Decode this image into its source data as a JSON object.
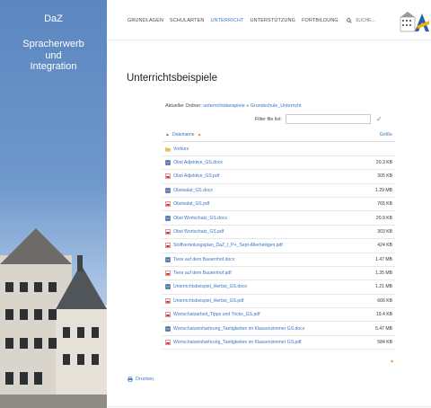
{
  "sidebar": {
    "brand_short": "DaZ",
    "brand_long_1": "Spracherwerb",
    "brand_long_2": "und",
    "brand_long_3": "Integration"
  },
  "nav": {
    "items": [
      "GRUNDLAGEN",
      "SCHULARTEN",
      "UNTERRICHT",
      "UNTERSTÜTZUNG",
      "FORTBILDUNG"
    ],
    "active_index": 2
  },
  "search": {
    "placeholder": "SUCHE..."
  },
  "page": {
    "title": "Unterrichtsbeispiele",
    "folder_label": "Aktueller Ordner:",
    "folder_link_1": "unterrichtsbeispiele",
    "folder_sep": "»",
    "folder_link_2": "Grundschule_Unterricht",
    "filter_label": "Filter file list:"
  },
  "listing": {
    "header_name": "Dateiname",
    "header_size": "Größe",
    "rows": [
      {
        "name": "Vorkurs",
        "size": "",
        "icon": "folder-icon"
      },
      {
        "name": "Obst Adjektive_GS.docx",
        "size": "20.3 KB",
        "icon": "word-icon"
      },
      {
        "name": "Obst Adjektive_GS.pdf",
        "size": "305 KB",
        "icon": "pdf-icon"
      },
      {
        "name": "Obstsalat_GS.docx",
        "size": "1.29 MB",
        "icon": "word-icon"
      },
      {
        "name": "Obstsalat_GS.pdf",
        "size": "765 KB",
        "icon": "pdf-icon"
      },
      {
        "name": "Obst Wortschatz_GS.docx",
        "size": "20.9 KB",
        "icon": "word-icon"
      },
      {
        "name": "Obst Wortschatz_GS.pdf",
        "size": "303 KB",
        "icon": "pdf-icon"
      },
      {
        "name": "Stoffverteilungsplan_DaZ_I_P+_Sept-Allerheiligen.pdf",
        "size": "424 KB",
        "icon": "pdf-icon"
      },
      {
        "name": "Tiere auf dem Bauernhof.docx",
        "size": "1.47 MB",
        "icon": "word-icon"
      },
      {
        "name": "Tiere auf dem Bauernhof.pdf",
        "size": "1.35 MB",
        "icon": "pdf-icon"
      },
      {
        "name": "Unterrichtsbeispiel_Herbst_GS.docx",
        "size": "1.21 MB",
        "icon": "word-icon"
      },
      {
        "name": "Unterrichtsbeispiel_Herbst_GS.pdf",
        "size": "666 KB",
        "icon": "pdf-icon"
      },
      {
        "name": "Wortschatzarbeit_Tipps und Tricks_GS.pdf",
        "size": "19.4 KB",
        "icon": "pdf-icon"
      },
      {
        "name": "Wortschatzeinfuehrung_Taetigkeiten im Klassenzimmer GS.docx",
        "size": "5.47 MB",
        "icon": "word-icon"
      },
      {
        "name": "Wortschatzeinfuehrung_Taetigkeiten im Klassenzimmer GS.pdf",
        "size": "584 KB",
        "icon": "pdf-icon"
      }
    ]
  },
  "print": {
    "label": "Drucken"
  },
  "colors": {
    "accent": "#3a75c4",
    "sidebar": "#5b86bf",
    "sort": "#e58a2a",
    "ok": "#4aa33a"
  }
}
